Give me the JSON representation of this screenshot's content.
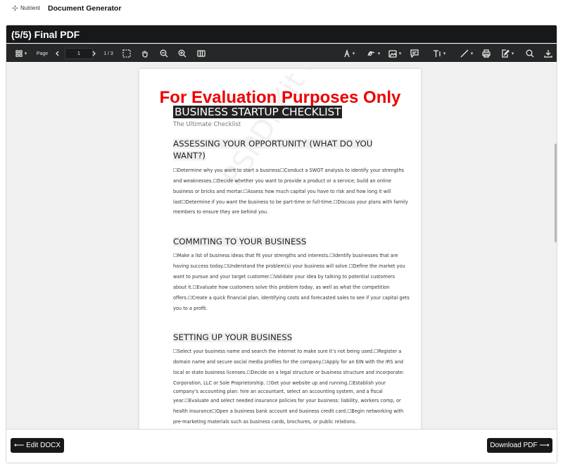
{
  "brand": {
    "name": "Nutrient"
  },
  "app": {
    "title": "Document Generator"
  },
  "step": {
    "title": "(5/5) Final PDF"
  },
  "toolbar": {
    "page_label": "Page",
    "page_value": "1",
    "page_total": "1 / 3",
    "icons": [
      "thumbnails-icon",
      "chevron-left-icon",
      "chevron-right-icon",
      "marquee-zoom-icon",
      "pan-hand-icon",
      "zoom-out-icon",
      "zoom-in-icon",
      "layout-icon",
      "ink-icon",
      "signature-icon",
      "image-icon",
      "comment-icon",
      "text-icon",
      "line-icon",
      "print-icon",
      "edit-icon",
      "search-icon",
      "download-icon"
    ]
  },
  "document": {
    "watermark": "For Evaluation Purposes Only",
    "faint_watermark": "PSPDFKit Evaluation Copy",
    "title": "BUSINESS STARTUP CHECKLIST",
    "subtitle": "The Ultimate Checklist",
    "sections": [
      {
        "heading_lines": [
          "ASSESSING YOUR OPPORTUNITY (WHAT DO YOU",
          "WANT?)"
        ],
        "lines": [
          "☐Determine why you want to start a business☐Conduct a SWOT analysis to identify your strengths",
          "and weaknesses.☐Decide whether you want to provide a product or a service; build an online",
          "business or bricks and mortar.☐Assess how much capital you have to risk and how long it will",
          "last☐Determine if you want the business to be part-time or full-time.☐Discuss your plans with family",
          "members to ensure they are behind you."
        ]
      },
      {
        "heading_lines": [
          "COMMITING TO YOUR BUSINESS"
        ],
        "lines": [
          "☐Make a list of business ideas that fit your strengths and interests.☐Identify businesses that are",
          "having success today.☐Understand the problem(s) your business will solve.☐Define the market you",
          "want to pursue and your target customer.☐Validate your idea by talking to potential customers",
          "about it.☐Evaluate how customers solve this problem today, as well as what the competition",
          "offers.☐Create a quick financial plan, identifying costs and forecasted sales to see if your capital gets",
          "you to a profit."
        ]
      },
      {
        "heading_lines": [
          "SETTING UP YOUR BUSINESS"
        ],
        "lines": [
          "☐Select your business name and search the internet to make sure it’s not being used.☐Register a",
          "domain name and secure social media profiles for the company.☐Apply for an EIN with the IRS and",
          "local or state business licenses.☐Decide on a legal structure or business structure and incorporate:",
          "Corporation, LLC or Sole Proprietorship. ☐Get your website up and running.☐Establish your",
          "company’s accounting plan: hire an accountant, select an accounting system, and a fiscal",
          "year.☐Evaluate and select needed insurance policies for your business: liability, workers comp, or",
          "health insurance☐Open a business bank account and business credit card.☐Begin networking with",
          "pre-marketing materials such as business cards, brochures, or public relations."
        ]
      }
    ]
  },
  "footer": {
    "back_label": "⟵ Edit DOCX",
    "next_label": "Download PDF ⟶"
  }
}
